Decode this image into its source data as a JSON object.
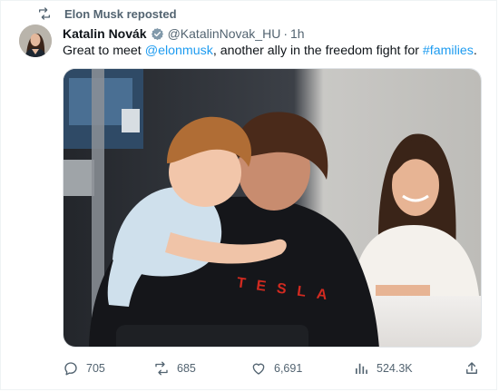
{
  "repost": {
    "label": "Elon Musk reposted"
  },
  "author": {
    "name": "Katalin Novák",
    "handle": "@KatalinNovak_HU",
    "separator": "·",
    "time": "1h"
  },
  "tweet": {
    "text_before": "Great to meet ",
    "mention": "@elonmusk",
    "text_middle": ", another ally in the freedom fight for ",
    "hashtag": "#families",
    "text_after": "."
  },
  "media": {
    "jacket_lettering": "TESLA"
  },
  "actions": {
    "replies": "705",
    "reposts": "685",
    "likes": "6,691",
    "views": "524.3K"
  },
  "colors": {
    "link": "#1d9bf0",
    "muted": "#536471",
    "verified": "#829aab",
    "tesla_red": "#d22a20"
  },
  "icons": [
    "repost-icon",
    "verified-badge-icon",
    "reply-icon",
    "repost-icon",
    "like-icon",
    "views-icon",
    "share-icon"
  ]
}
